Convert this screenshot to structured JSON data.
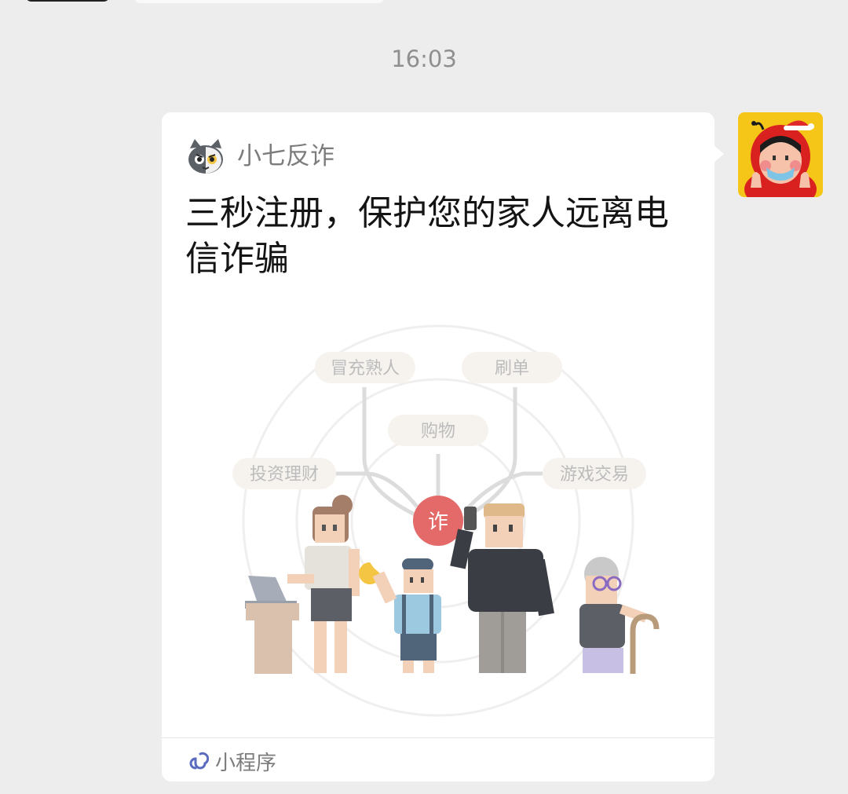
{
  "timestamp": "16:03",
  "card": {
    "source_name": "小七反诈",
    "title": "三秒注册，保护您的家人远离电信诈骗",
    "footer_label": "小程序",
    "illustration": {
      "tags": {
        "impersonate": "冒充熟人",
        "brushing": "刷单",
        "shopping": "购物",
        "investment": "投资理财",
        "game_trade": "游戏交易"
      },
      "center_label": "诈"
    }
  },
  "icons": {
    "source_logo": "cat-mascot-logo-icon",
    "footer_icon": "mini-program-link-icon",
    "avatar": "user-avatar-red-hood-icon"
  },
  "colors": {
    "background": "#ededed",
    "card": "#ffffff",
    "mini_program": "#5b6bbf",
    "fraud_center": "#e46a6a"
  }
}
